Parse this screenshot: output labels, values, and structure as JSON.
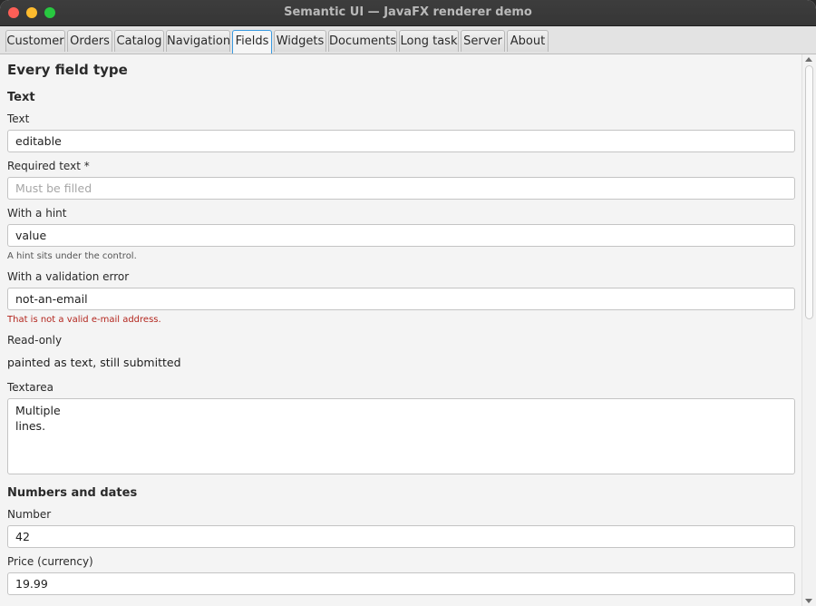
{
  "window": {
    "title": "Semantic UI — JavaFX renderer demo"
  },
  "tabs": [
    {
      "label": "Customer"
    },
    {
      "label": "Orders"
    },
    {
      "label": "Catalog"
    },
    {
      "label": "Navigation"
    },
    {
      "label": "Fields",
      "active": true
    },
    {
      "label": "Widgets"
    },
    {
      "label": "Documents"
    },
    {
      "label": "Long task"
    },
    {
      "label": "Server"
    },
    {
      "label": "About"
    }
  ],
  "page": {
    "title": "Every field type",
    "sections": {
      "text": {
        "heading": "Text",
        "text_field": {
          "label": "Text",
          "value": "editable"
        },
        "required_field": {
          "label": "Required text *",
          "placeholder": "Must be filled"
        },
        "hint_field": {
          "label": "With a hint",
          "value": "value",
          "hint": "A hint sits under the control."
        },
        "error_field": {
          "label": "With a validation error",
          "value": "not-an-email",
          "error": "That is not a valid e-mail address."
        },
        "readonly_field": {
          "label": "Read-only",
          "value": "painted as text, still submitted"
        },
        "textarea_field": {
          "label": "Textarea",
          "value": "Multiple\nlines."
        }
      },
      "numbers": {
        "heading": "Numbers and dates",
        "number_field": {
          "label": "Number",
          "value": "42"
        },
        "price_field": {
          "label": "Price (currency)",
          "value": "19.99"
        }
      }
    }
  },
  "colors": {
    "accent": "#3a9ae0",
    "error": "#b3261e",
    "hint": "#555555"
  }
}
